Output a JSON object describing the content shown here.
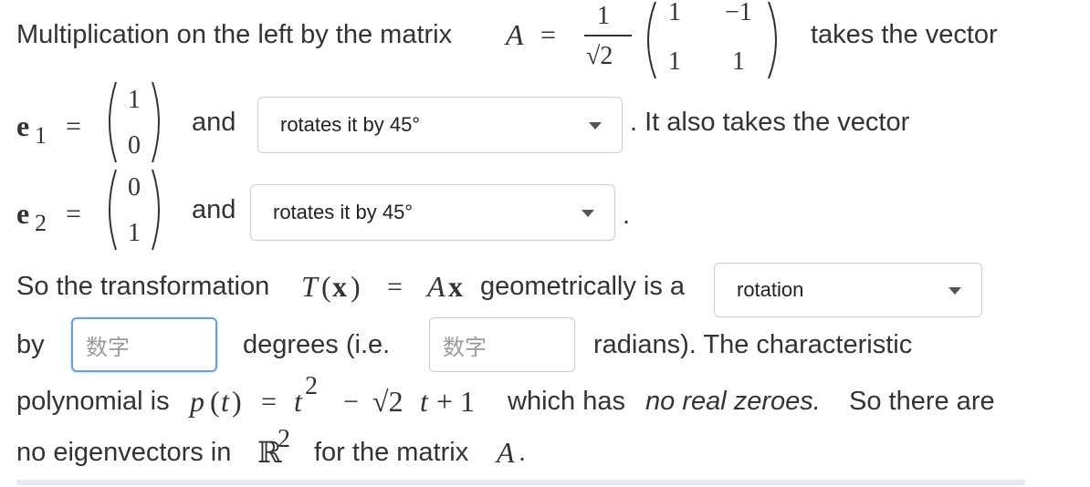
{
  "line1": {
    "prefix": "Multiplication on the left by the matrix",
    "matrix_symbol": "A",
    "equals": "=",
    "frac_num": "1",
    "frac_den": "√2",
    "matrix": [
      [
        "1",
        "−1"
      ],
      [
        "1",
        "1"
      ]
    ],
    "suffix": "takes the vector"
  },
  "e1": {
    "symbol": "e",
    "subscript": "1",
    "equals": "=",
    "vector": [
      "1",
      "0"
    ],
    "and": "and",
    "dropdown_value": "rotates it by 45°",
    "after": ". It also takes the vector"
  },
  "e2": {
    "symbol": "e",
    "subscript": "2",
    "equals": "=",
    "vector": [
      "0",
      "1"
    ],
    "and": "and",
    "dropdown_value": "rotates it by 45°",
    "after": "."
  },
  "transform": {
    "prefix": "So the transformation",
    "T": "T",
    "x_open": "(",
    "x": "x",
    "x_close": ")",
    "equals": "=",
    "A": "A",
    "x2": "x",
    "suffix": "geometrically is a",
    "dropdown_value": "rotation"
  },
  "by_line": {
    "by": "by",
    "degrees_placeholder": "数字",
    "degrees_text": "degrees (i.e.",
    "radians_placeholder": "数字",
    "radians_text": "radians). The characteristic"
  },
  "poly_line": {
    "prefix": "polynomial is",
    "p": "p",
    "t_arg_open": "(",
    "t_arg": "t",
    "t_arg_close": ")",
    "equals": "=",
    "t": "t",
    "exp": "2",
    "minus": "−",
    "sqrt2": "√2",
    "t2": "t",
    "plus_one": "+ 1",
    "which_has": "which has",
    "no_real": "no real zeroes.",
    "so_there": "So there are"
  },
  "last_line": {
    "prefix": "no eigenvectors in",
    "R": "ℝ",
    "R_exp": "2",
    "suffix": "for the matrix",
    "A": "A",
    "period": "."
  },
  "colors": {
    "text": "#333333",
    "focus_border": "#6aa0d8",
    "bottom_bar": "#e7e7f6"
  }
}
